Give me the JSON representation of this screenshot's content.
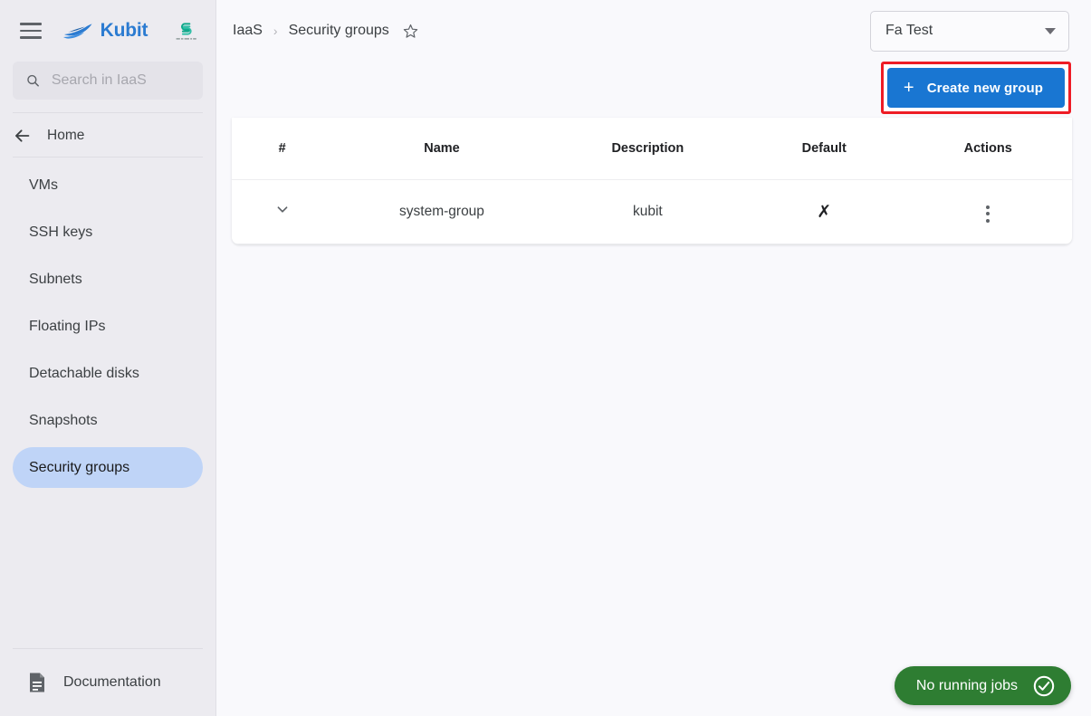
{
  "app": {
    "brand_name": "Kubit",
    "brand_mark_icon": "boat-swoosh-icon",
    "tenant_logo_icon": "tenant-s-logo-icon",
    "menu_icon": "hamburger-menu-icon"
  },
  "colors": {
    "accent_blue": "#1976D2",
    "brand_blue": "#2B7BD1",
    "active_nav": "#BFD4F7",
    "sidebar_bg": "#ECEBF0",
    "main_bg": "#F9F9FC",
    "toast_green": "#2E7D32",
    "highlight_red": "#EE1C25"
  },
  "sidebar": {
    "search": {
      "icon": "search-icon",
      "value": "",
      "placeholder": "Search in IaaS"
    },
    "home": {
      "label": "Home",
      "icon": "arrow-left-icon"
    },
    "items": [
      {
        "label": "VMs",
        "active": false
      },
      {
        "label": "SSH keys",
        "active": false
      },
      {
        "label": "Subnets",
        "active": false
      },
      {
        "label": "Floating IPs",
        "active": false
      },
      {
        "label": "Detachable disks",
        "active": false
      },
      {
        "label": "Snapshots",
        "active": false
      },
      {
        "label": "Security groups",
        "active": true
      }
    ],
    "documentation": {
      "label": "Documentation",
      "icon": "document-icon"
    }
  },
  "header": {
    "breadcrumb": [
      {
        "label": "IaaS"
      },
      {
        "label": "Security groups"
      }
    ],
    "breadcrumb_separator": "›",
    "favorite_icon": "star-outline-icon",
    "tenant_select": {
      "value": "Fa Test",
      "caret_icon": "chevron-down-icon"
    }
  },
  "toolbar": {
    "create_label": "Create new group",
    "create_plus_icon": "plus-icon",
    "highlighted": true
  },
  "table": {
    "columns": [
      "#",
      "Name",
      "Description",
      "Default",
      "Actions"
    ],
    "rows": [
      {
        "expand_icon": "chevron-down-icon",
        "name": "system-group",
        "description": "kubit",
        "default": "✗",
        "actions_icon": "kebab-menu-icon"
      }
    ]
  },
  "status": {
    "jobs_label": "No running jobs",
    "jobs_icon": "check-circle-icon"
  }
}
